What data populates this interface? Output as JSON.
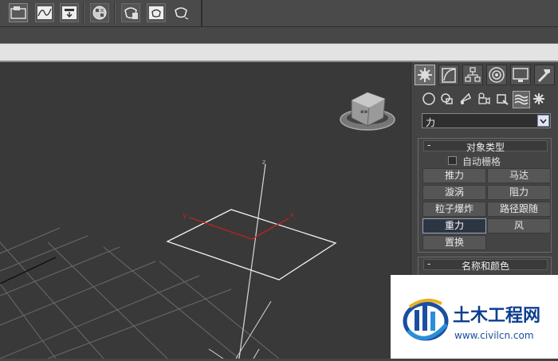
{
  "toolbar": {
    "icons": [
      "layer-manager-icon",
      "curve-editor-icon",
      "schematic-icon",
      "material-editor-icon",
      "render-setup-icon",
      "rendered-frame-icon",
      "render-icon"
    ]
  },
  "command_panel": {
    "tabs": [
      "create",
      "modify",
      "hierarchy",
      "motion",
      "display",
      "utilities"
    ],
    "categories": [
      "geometry",
      "shapes",
      "lights",
      "cameras",
      "helpers",
      "space-warps",
      "systems"
    ],
    "category_dropdown": {
      "value": "力"
    },
    "object_type_rollout": {
      "title": "对象类型",
      "collapse": "-",
      "auto_grid": "自动栅格",
      "buttons": [
        "推力",
        "马达",
        "漩涡",
        "阻力",
        "粒子爆炸",
        "路径跟随",
        "重力",
        "风",
        "置换"
      ],
      "active_button": "重力"
    },
    "name_color_rollout": {
      "title": "名称和颜色",
      "collapse": "-"
    }
  },
  "viewport": {
    "axis_labels": {
      "x": "x",
      "y": "y",
      "z": "z"
    },
    "colors": {
      "background": "#393939",
      "grid": "#6b6b6b",
      "gizmo": "#ffffff",
      "axis_red": "#c02020"
    }
  },
  "watermark": {
    "name": "土木工程网",
    "url": "www.civilcn.com"
  }
}
